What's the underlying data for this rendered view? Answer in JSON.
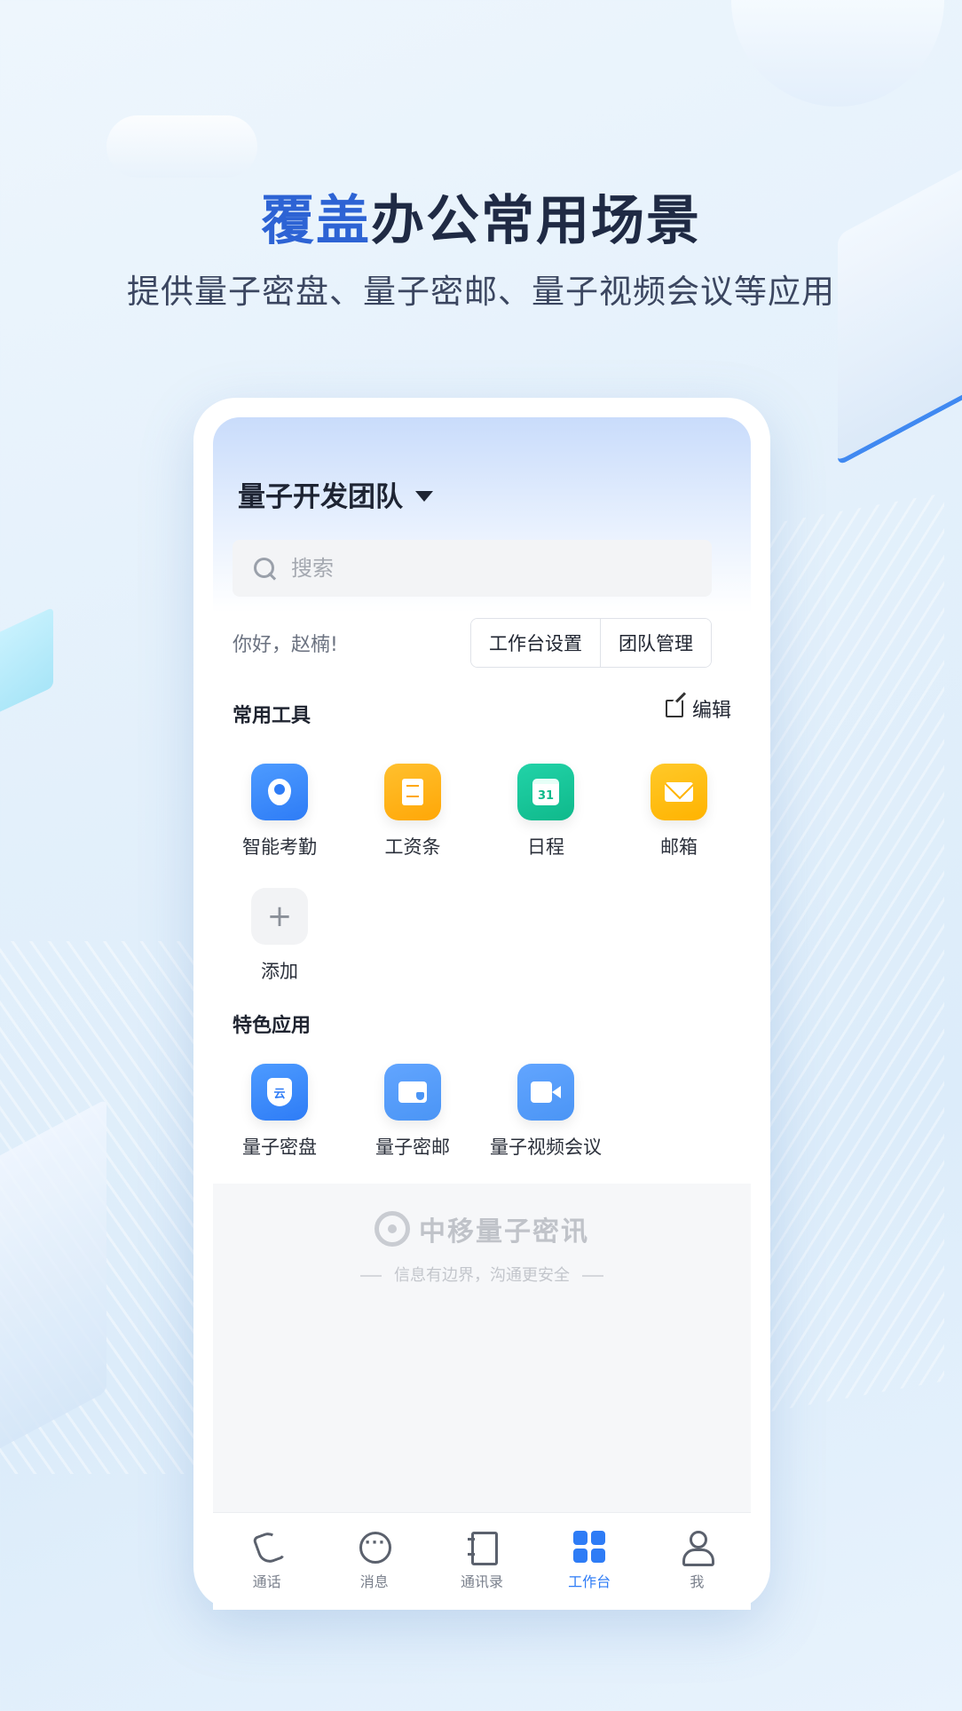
{
  "headline": {
    "accent": "覆盖",
    "rest": "办公常用场景"
  },
  "subline": "提供量子密盘、量子密邮、量子视频会议等应用",
  "phone": {
    "team_name": "量子开发团队",
    "search": {
      "placeholder": "搜索"
    },
    "greeting": "你好，赵楠!",
    "buttons": {
      "workbench_settings": "工作台设置",
      "team_manage": "团队管理"
    },
    "common_tools": {
      "title": "常用工具",
      "edit_label": "编辑",
      "items": [
        {
          "label": "智能考勤",
          "icon": "location-pin-icon",
          "color": "#2E7CF6"
        },
        {
          "label": "工资条",
          "icon": "payslip-icon",
          "color": "#FFA707"
        },
        {
          "label": "日程",
          "icon": "calendar-icon",
          "color": "#0FB98B",
          "day": "31"
        },
        {
          "label": "邮箱",
          "icon": "mail-icon",
          "color": "#FFB300"
        },
        {
          "label": "添加",
          "icon": "plus-icon",
          "color": "#F2F3F5"
        }
      ]
    },
    "featured_apps": {
      "title": "特色应用",
      "items": [
        {
          "label": "量子密盘",
          "icon": "cloud-shield-icon",
          "color": "#2E7CF6",
          "glyph": "云"
        },
        {
          "label": "量子密邮",
          "icon": "secure-mail-icon",
          "color": "#4B95F5"
        },
        {
          "label": "量子视频会议",
          "icon": "video-camera-icon",
          "color": "#4B95F5"
        }
      ]
    },
    "brand": {
      "name": "中移量子密讯",
      "slogan": "信息有边界，沟通更安全"
    },
    "tabbar": [
      {
        "label": "通话",
        "icon": "phone-icon",
        "active": false
      },
      {
        "label": "消息",
        "icon": "message-icon",
        "active": false
      },
      {
        "label": "通讯录",
        "icon": "contacts-icon",
        "active": false
      },
      {
        "label": "工作台",
        "icon": "workbench-grid-icon",
        "active": true
      },
      {
        "label": "我",
        "icon": "profile-icon",
        "active": false
      }
    ]
  },
  "colors": {
    "accent": "#2D63D4",
    "active_tab": "#2E7CF6",
    "headline": "#1F2A44"
  }
}
